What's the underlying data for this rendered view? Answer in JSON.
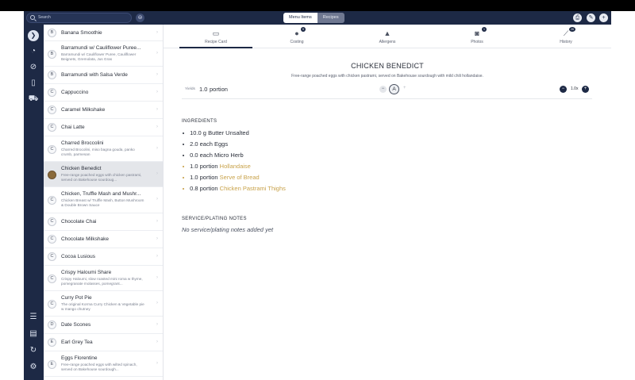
{
  "header": {
    "search_placeholder": "Search",
    "seg_menu_items": "Menu Items",
    "seg_recipes": "Recipes",
    "icons": [
      "filter-icon",
      "print-icon",
      "edit-icon",
      "add-icon"
    ]
  },
  "rail": {
    "icons": [
      "chevron-right-icon",
      "dashboard-icon",
      "costing-off-icon",
      "book-icon",
      "truck-icon",
      "checklist-icon",
      "document-icon",
      "sync-icon",
      "settings-icon"
    ]
  },
  "list": {
    "items": [
      {
        "letter": "B",
        "title": "Banana Smoothie",
        "desc": ""
      },
      {
        "letter": "B",
        "title": "Barramundi w/ Cauliflower Puree...",
        "desc": "Barramundi w/ Cauliflower Puree, Cauliflower Beignets, Gremolata, Jus Gras"
      },
      {
        "letter": "B",
        "title": "Barramundi with Salsa Verde",
        "desc": ""
      },
      {
        "letter": "C",
        "title": "Cappuccino",
        "desc": ""
      },
      {
        "letter": "C",
        "title": "Caramel Milkshake",
        "desc": ""
      },
      {
        "letter": "C",
        "title": "Chai Latte",
        "desc": ""
      },
      {
        "letter": "C",
        "title": "Charred Broccolini",
        "desc": "Charred Brocolini, miso bagna gouda, panko crumb, parmesan"
      },
      {
        "letter": "",
        "title": "Chicken Benedict",
        "desc": "Free-range poached eggs with chicken pastrami, served on Bakehouse sourdoug..."
      },
      {
        "letter": "C",
        "title": "Chicken, Truffle Mash and Mushr...",
        "desc": "Chicken Breast w/ Truffle Mash, Button Mushroom & Double Brown Sauce"
      },
      {
        "letter": "C",
        "title": "Chocolate Chai",
        "desc": ""
      },
      {
        "letter": "C",
        "title": "Chocolate Milkshake",
        "desc": ""
      },
      {
        "letter": "C",
        "title": "Cocoa Lusious",
        "desc": ""
      },
      {
        "letter": "C",
        "title": "Crispy Haloumi Share",
        "desc": "Crispy Haloumi, slow roasted mini roma w thyme, pomegranate  molasses, pomegrant..."
      },
      {
        "letter": "C",
        "title": "Curry Pot Pie",
        "desc": "The original Korma Curry Chicken & Vegetable pie w mango chutney"
      },
      {
        "letter": "D",
        "title": "Date Scones",
        "desc": ""
      },
      {
        "letter": "E",
        "title": "Earl Grey Tea",
        "desc": ""
      },
      {
        "letter": "E",
        "title": "Eggs Florentine",
        "desc": "Free-range poached eggs with wilted spinach, served on Bakehouse sourdough..."
      }
    ]
  },
  "tabs": [
    {
      "label": "Recipe Card",
      "icon": "recipe-card-icon",
      "badge": ""
    },
    {
      "label": "Costing",
      "icon": "costing-icon",
      "badge": "5"
    },
    {
      "label": "Allergens",
      "icon": "warning-icon",
      "badge": ""
    },
    {
      "label": "Photos",
      "icon": "camera-icon",
      "badge": "1"
    },
    {
      "label": "History",
      "icon": "history-icon",
      "badge": "26"
    }
  ],
  "recipe": {
    "title": "CHICKEN BENEDICT",
    "subtitle": "Free-range poached eggs with chicken pastrami, served on Bakehouse sourdough with mild chili  hollandaise.",
    "yield_label": "Yields",
    "yield_value": "1.0",
    "yield_unit": "portion",
    "aa_label": "A",
    "scale": "1.0x",
    "ingredients_heading": "INGREDIENTS",
    "ingredients": [
      {
        "qty": "10.0",
        "unit": "g",
        "name": "Butter Unsalted",
        "link": false
      },
      {
        "qty": "2.0",
        "unit": "each",
        "name": "Eggs",
        "link": false
      },
      {
        "qty": "0.0",
        "unit": "each",
        "name": "Micro Herb",
        "link": false
      },
      {
        "qty": "1.0",
        "unit": "portion",
        "name": "Hollandaise",
        "link": true
      },
      {
        "qty": "1.0",
        "unit": "portion",
        "name": "Serve of Bread",
        "link": true
      },
      {
        "qty": "0.8",
        "unit": "portion",
        "name": "Chicken Pastrami Thighs",
        "link": true
      }
    ],
    "notes_heading": "SERVICE/PLATING NOTES",
    "notes_text": "No service/plating notes added yet"
  },
  "colors": {
    "navy": "#1d2945",
    "link_gold": "#c8a24a"
  }
}
